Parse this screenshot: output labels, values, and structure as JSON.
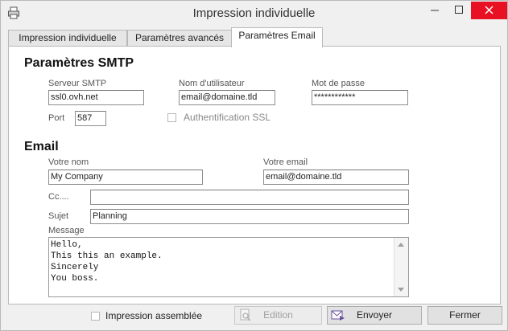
{
  "window": {
    "title": "Impression individuelle"
  },
  "tabs": [
    {
      "label": "Impression individuelle"
    },
    {
      "label": "Paramètres avancés"
    },
    {
      "label": "Paramètres Email"
    }
  ],
  "active_tab": "Paramètres Email",
  "smtp": {
    "heading": "Paramètres SMTP",
    "server_label": "Serveur SMTP",
    "server_value": "ssl0.ovh.net",
    "user_label": "Nom d'utilisateur",
    "user_value": "email@domaine.tld",
    "password_label": "Mot de passe",
    "password_value": "************",
    "port_label": "Port",
    "port_value": "587",
    "ssl_label": "Authentification SSL",
    "ssl_checked": false
  },
  "email": {
    "heading": "Email",
    "name_label": "Votre nom",
    "name_value": "My Company",
    "email_label": "Votre email",
    "email_value": "email@domaine.tld",
    "cc_label": "Cc....",
    "cc_value": "",
    "subject_label": "Sujet",
    "subject_value": "Planning",
    "message_label": "Message",
    "message_lines": [
      "Hello,",
      "This this an example.",
      "Sincerely",
      "You boss."
    ]
  },
  "footer": {
    "assembled_label": "Impression assemblée",
    "assembled_checked": false,
    "edit_label": "Edition",
    "send_label": "Envoyer",
    "close_label": "Fermer"
  },
  "colors": {
    "close_button": "#e81123",
    "disabled_text": "#a0a0a0"
  }
}
